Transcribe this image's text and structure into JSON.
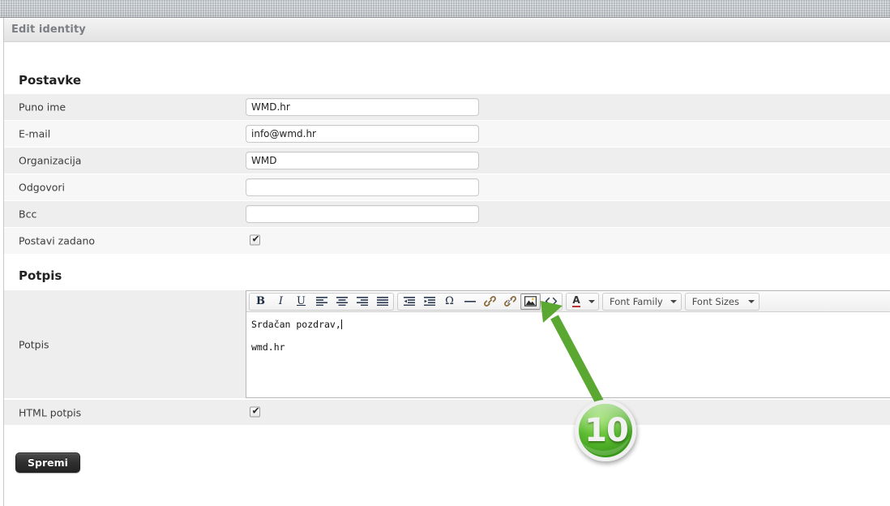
{
  "window": {
    "title": "Edit identity"
  },
  "sections": {
    "settings_heading": "Postavke",
    "signature_heading": "Potpis"
  },
  "form": {
    "fields": [
      {
        "label": "Puno ime",
        "value": "WMD.hr",
        "type": "text",
        "placeholder": ""
      },
      {
        "label": "E-mail",
        "value": "info@wmd.hr",
        "type": "text",
        "placeholder": ""
      },
      {
        "label": "Organizacija",
        "value": "WMD",
        "type": "text",
        "placeholder": ""
      },
      {
        "label": "Odgovori",
        "value": "",
        "type": "text",
        "placeholder": ""
      },
      {
        "label": "Bcc",
        "value": "",
        "type": "text",
        "placeholder": ""
      },
      {
        "label": "Postavi zadano",
        "value": "",
        "type": "checkbox",
        "checked": true
      }
    ],
    "signature_row_label": "Potpis",
    "html_signature": {
      "label": "HTML potpis",
      "checked": true
    }
  },
  "editor": {
    "toolbar": {
      "group1": [
        {
          "name": "bold-icon",
          "glyph": "B"
        },
        {
          "name": "italic-icon",
          "glyph": "I"
        },
        {
          "name": "underline-icon",
          "glyph": "U"
        },
        {
          "name": "align-left-icon",
          "glyph": ""
        },
        {
          "name": "align-center-icon",
          "glyph": ""
        },
        {
          "name": "align-right-icon",
          "glyph": ""
        },
        {
          "name": "align-justify-icon",
          "glyph": ""
        }
      ],
      "group2": [
        {
          "name": "outdent-icon",
          "glyph": ""
        },
        {
          "name": "indent-icon",
          "glyph": ""
        },
        {
          "name": "special-char-icon",
          "glyph": "Ω"
        },
        {
          "name": "horizontal-rule-icon",
          "glyph": "—"
        },
        {
          "name": "insert-link-icon",
          "glyph": ""
        },
        {
          "name": "unlink-icon",
          "glyph": ""
        },
        {
          "name": "insert-image-icon",
          "glyph": "",
          "active": true
        },
        {
          "name": "source-code-icon",
          "glyph": "<>"
        }
      ],
      "text_color": {
        "name": "text-color-icon",
        "letter": "A"
      },
      "font_family_label": "Font Family",
      "font_sizes_label": "Font Sizes"
    },
    "content": {
      "line1": "Srdačan pozdrav,",
      "line2": "wmd.hr"
    }
  },
  "actions": {
    "submit_label": "Spremi"
  },
  "annotation": {
    "badge_number": "10",
    "badge_color": "#4caf28",
    "arrow_color": "#5aa832"
  }
}
